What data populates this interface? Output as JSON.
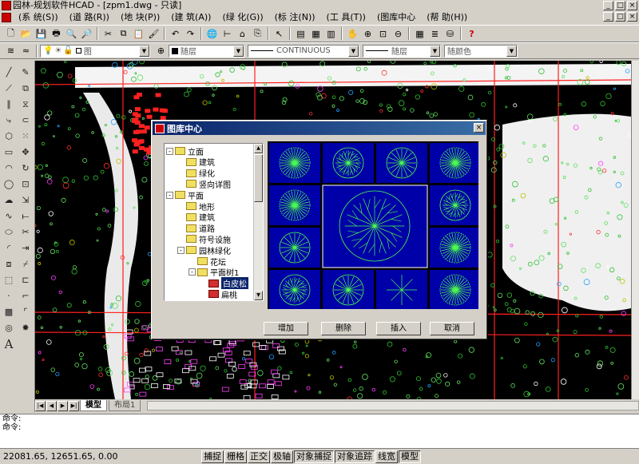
{
  "window": {
    "title": "园林-规划软件HCAD - [zpm1.dwg - 只读]",
    "buttons": [
      "_",
      "□",
      "×"
    ]
  },
  "menu": [
    "(系 统(S))",
    "(道 路(R))",
    "(地 块(P))",
    "(建 筑(A))",
    "(绿 化(G))",
    "(标 注(N))",
    "(工 具(T))",
    "(图库中心",
    "(帮 助(H))"
  ],
  "layer_toolbar": {
    "layer_combo": "图",
    "color_combo": "随层",
    "linetype_combo": "CONTINUOUS",
    "lineweight_combo": "随层",
    "plotstyle_combo": "随颜色"
  },
  "layout_tabs": [
    "模型",
    "布局1"
  ],
  "command": {
    "lines": [
      "命令:",
      "命令:"
    ]
  },
  "status": {
    "coords": "22081.65, 12651.65, 0.00",
    "toggles": [
      "捕捉",
      "栅格",
      "正交",
      "极轴",
      "对象捕捉",
      "对象追踪",
      "线宽",
      "模型"
    ]
  },
  "dialog": {
    "title": "图库中心",
    "tree": [
      {
        "label": "立面",
        "depth": 0,
        "exp": "-"
      },
      {
        "label": "建筑",
        "depth": 1
      },
      {
        "label": "绿化",
        "depth": 1
      },
      {
        "label": "竖向详图",
        "depth": 1
      },
      {
        "label": "平面",
        "depth": 0,
        "exp": "-"
      },
      {
        "label": "地形",
        "depth": 1
      },
      {
        "label": "建筑",
        "depth": 1
      },
      {
        "label": "道路",
        "depth": 1
      },
      {
        "label": "符号设施",
        "depth": 1
      },
      {
        "label": "园林绿化",
        "depth": 1,
        "exp": "-"
      },
      {
        "label": "花坛",
        "depth": 2
      },
      {
        "label": "平面树1",
        "depth": 2,
        "exp": "-"
      },
      {
        "label": "白皮松",
        "depth": 3,
        "leaf": true,
        "selected": true
      },
      {
        "label": "扁桃",
        "depth": 3,
        "leaf": true
      }
    ],
    "buttons": {
      "add": "增加",
      "delete": "删除",
      "insert": "插入",
      "cancel": "取消"
    }
  },
  "colors": {
    "title_gradient_start": "#0a246a",
    "preview_bg": "#0000a8",
    "cad_bg": "#000000",
    "symbol_green": "#4cff4c"
  }
}
